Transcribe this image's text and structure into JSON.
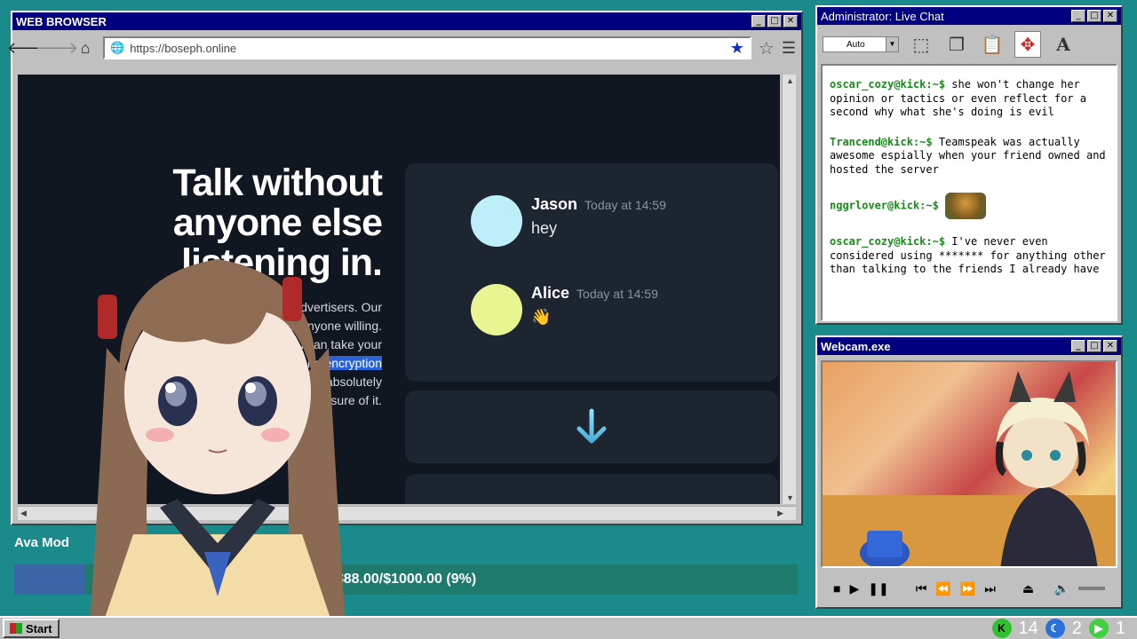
{
  "browser": {
    "title": "WEB BROWSER",
    "url": "https://boseph.online",
    "hero_title": "Talk without anyone else listening in.",
    "body_lines": [
      "Revolt will never show you advertisers. Our",
      "code is open and anyone willing.",
      "Based on that you can take your",
      "privacy further with end-to-end encryption",
      "coming to Revolt, so you can be absolutely",
      "sure of it."
    ],
    "highlight_text": "encryption",
    "messages": [
      {
        "name": "Jason",
        "time": "Today at 14:59",
        "text": "hey",
        "avatar_color": "#bdeefa"
      },
      {
        "name": "Alice",
        "time": "Today at 14:59",
        "text": "👋",
        "avatar_color": "#e8f590"
      }
    ]
  },
  "chat": {
    "title": "Administrator: Live Chat",
    "font_select": "Auto",
    "entries": [
      {
        "user": "oscar_cozy@kick:~$",
        "text": " she won't change her opinion or tactics or even reflect for a second why what she's doing is evil"
      },
      {
        "user": "Trancend@kick:~$",
        "text": " Teamspeak was actually awesome espially when your friend owned and hosted the server"
      },
      {
        "user": "nggrlover@kick:~$",
        "text": ""
      },
      {
        "user": "oscar_cozy@kick:~$",
        "text": " I've never even considered using ******* for anything other than talking to the friends I already have"
      }
    ]
  },
  "webcam": {
    "title": "Webcam.exe"
  },
  "goal": {
    "label": "Ava Mod",
    "text": "$88.00/$1000.00 (9%)",
    "fraction": 0.09
  },
  "taskbar": {
    "start_label": "Start",
    "tray_count_1": "14",
    "tray_count_2": "2",
    "tray_count_3": "1"
  },
  "colors": {
    "desktop": "#1a8a8a",
    "titlebar": "#000080",
    "username": "#188c18",
    "goal_fill": "#3a66a8"
  }
}
